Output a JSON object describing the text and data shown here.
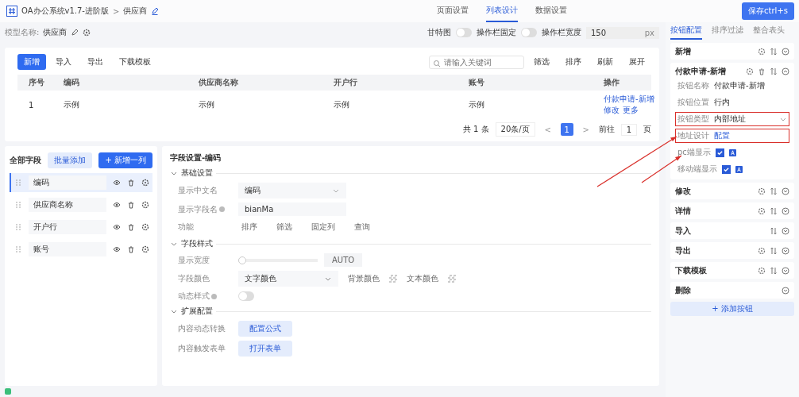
{
  "header": {
    "title": "OA办公系统v1.7-进阶版",
    "separator": ">",
    "page": "供应商",
    "save_button": "保存ctrl+s"
  },
  "tabs": [
    {
      "label": "页面设置",
      "selected": false
    },
    {
      "label": "列表设计",
      "selected": true
    },
    {
      "label": "数据设置",
      "selected": false
    }
  ],
  "model": {
    "label": "模型名称:",
    "value": "供应商"
  },
  "options": [
    {
      "label": "甘特图",
      "kind": "toggle",
      "on": false
    },
    {
      "label": "操作栏固定",
      "kind": "toggle",
      "on": false
    },
    {
      "label": "操作栏宽度",
      "kind": "number",
      "value": "150",
      "unit": "px"
    }
  ],
  "toolbar": {
    "buttons": [
      {
        "label": "新增",
        "primary": true
      },
      {
        "label": "导入",
        "primary": false
      },
      {
        "label": "导出",
        "primary": false
      },
      {
        "label": "下载模板",
        "primary": false
      }
    ],
    "search": {
      "placeholder": "请输入关键词"
    },
    "actions": [
      "筛选",
      "排序",
      "刷新",
      "展开"
    ]
  },
  "table": {
    "columns": [
      "序号",
      "编码",
      "供应商名称",
      "开户行",
      "账号",
      "操作"
    ],
    "rows": [
      {
        "cells": [
          "1",
          "示例",
          "示例",
          "示例",
          "示例"
        ],
        "links": [
          "付款申请-新增",
          "修改",
          "更多"
        ]
      }
    ]
  },
  "pagination": {
    "total": "共 1 条",
    "page_size": "20条/页",
    "prev": "<",
    "pages": [
      {
        "label": "1",
        "selected": true
      }
    ],
    "next": ">",
    "goto": "前往",
    "goto_value": "1",
    "goto_unit": "页"
  },
  "fields_panel": {
    "title": "全部字段",
    "batch_button": "批量添加",
    "add_button": "+ 新增一列",
    "fields": [
      {
        "name": "编码",
        "selected": true
      },
      {
        "name": "供应商名称",
        "selected": false
      },
      {
        "name": "开户行",
        "selected": false
      },
      {
        "name": "账号",
        "selected": false
      }
    ]
  },
  "field_settings": {
    "title": "字段设置-编码",
    "sections": [
      {
        "title": "基础设置",
        "expanded": true,
        "rows": [
          {
            "kind": "select",
            "label": "显示中文名",
            "value": "编码"
          },
          {
            "kind": "input",
            "label": "显示字段名",
            "info": true,
            "value": "bianMa"
          },
          {
            "kind": "chips",
            "label": "功能",
            "chips": [
              "排序",
              "筛选",
              "固定列",
              "查询"
            ]
          }
        ]
      },
      {
        "title": "字段样式",
        "expanded": true,
        "rows": [
          {
            "kind": "slider",
            "label": "显示宽度",
            "level": 0,
            "value": "AUTO"
          },
          {
            "kind": "colors",
            "label": "字段颜色",
            "value": "文字颜色",
            "bg_label": "背景颜色",
            "text_label": "文本颜色"
          },
          {
            "kind": "toggle",
            "label": "动态样式",
            "info": true,
            "on": false
          }
        ]
      },
      {
        "title": "扩展配置",
        "expanded": true,
        "rows": [
          {
            "kind": "button",
            "label": "内容动态转换",
            "button": "配置公式"
          },
          {
            "kind": "button",
            "label": "内容触发表单",
            "button": "打开表单"
          }
        ]
      }
    ]
  },
  "right_panel": {
    "tabs": [
      {
        "label": "按钮配置",
        "selected": true
      },
      {
        "label": "排序过滤",
        "selected": false
      },
      {
        "label": "整合表头",
        "selected": false
      }
    ],
    "buttons": [
      {
        "name": "新增",
        "expanded": false,
        "settings": true,
        "delete": false,
        "move": true
      },
      {
        "name": "付款申请-新增",
        "expanded": true,
        "settings": true,
        "delete": true,
        "move": true,
        "props": [
          {
            "kind": "text",
            "label": "按钮名称",
            "value": "付款申请-新增",
            "highlighted": false
          },
          {
            "kind": "text",
            "label": "按钮位置",
            "value": "行内",
            "highlighted": false
          },
          {
            "kind": "select",
            "label": "按钮类型",
            "value": "内部地址",
            "highlighted": true
          },
          {
            "kind": "link",
            "label": "地址设计",
            "value": "配置",
            "highlighted": true
          },
          {
            "kind": "check",
            "label": "pc端显示",
            "checked": true,
            "highlighted": false
          },
          {
            "kind": "check",
            "label": "移动端显示",
            "checked": true,
            "highlighted": false
          }
        ]
      },
      {
        "name": "修改",
        "expanded": false,
        "settings": true,
        "delete": false,
        "move": true
      },
      {
        "name": "详情",
        "expanded": false,
        "settings": true,
        "delete": false,
        "move": true
      },
      {
        "name": "导入",
        "expanded": false,
        "settings": false,
        "delete": false,
        "move": true
      },
      {
        "name": "导出",
        "expanded": false,
        "settings": true,
        "delete": false,
        "move": true
      },
      {
        "name": "下载模板",
        "expanded": false,
        "settings": true,
        "delete": false,
        "move": true
      },
      {
        "name": "删除",
        "expanded": false,
        "settings": false,
        "delete": false,
        "move": false
      }
    ],
    "add_button": "+ 添加按钮"
  }
}
